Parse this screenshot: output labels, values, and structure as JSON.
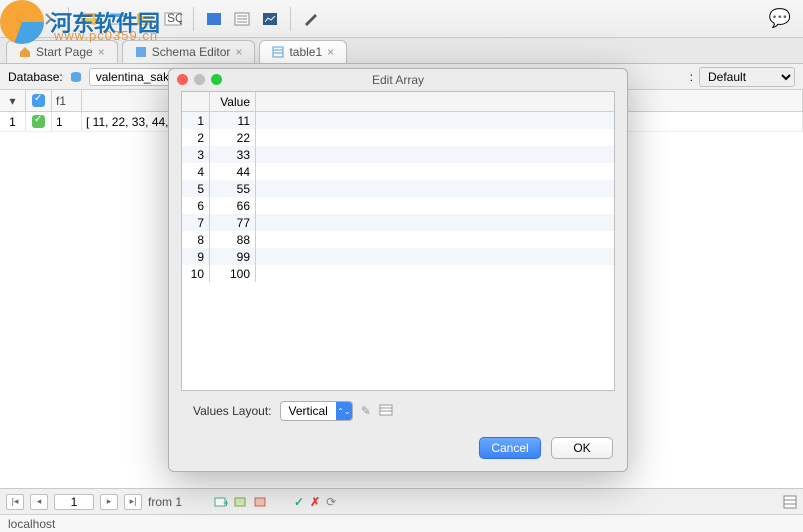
{
  "watermark": {
    "title": "河东软件园",
    "url": "www.pc0359.cn"
  },
  "toolbar": {},
  "tabs": [
    {
      "label": "Start Page"
    },
    {
      "label": "Schema Editor"
    },
    {
      "label": "table1"
    }
  ],
  "dbbar": {
    "label": "Database:",
    "db_value": "valentina_sakila",
    "right_label": ":",
    "right_value": "Default"
  },
  "grid": {
    "col_f1": "f1",
    "row1": {
      "num": "1",
      "f1": "1",
      "arr": "[ 11, 22, 33, 44, ..."
    }
  },
  "dialog": {
    "title": "Edit Array",
    "value_header": "Value",
    "rows": [
      {
        "i": "1",
        "v": "11"
      },
      {
        "i": "2",
        "v": "22"
      },
      {
        "i": "3",
        "v": "33"
      },
      {
        "i": "4",
        "v": "44"
      },
      {
        "i": "5",
        "v": "55"
      },
      {
        "i": "6",
        "v": "66"
      },
      {
        "i": "7",
        "v": "77"
      },
      {
        "i": "8",
        "v": "88"
      },
      {
        "i": "9",
        "v": "99"
      },
      {
        "i": "10",
        "v": "100"
      }
    ],
    "layout_label": "Values Layout:",
    "layout_value": "Vertical",
    "cancel": "Cancel",
    "ok": "OK"
  },
  "footer": {
    "pos": "1",
    "from_label": "from 1"
  },
  "status": {
    "text": "localhost"
  }
}
